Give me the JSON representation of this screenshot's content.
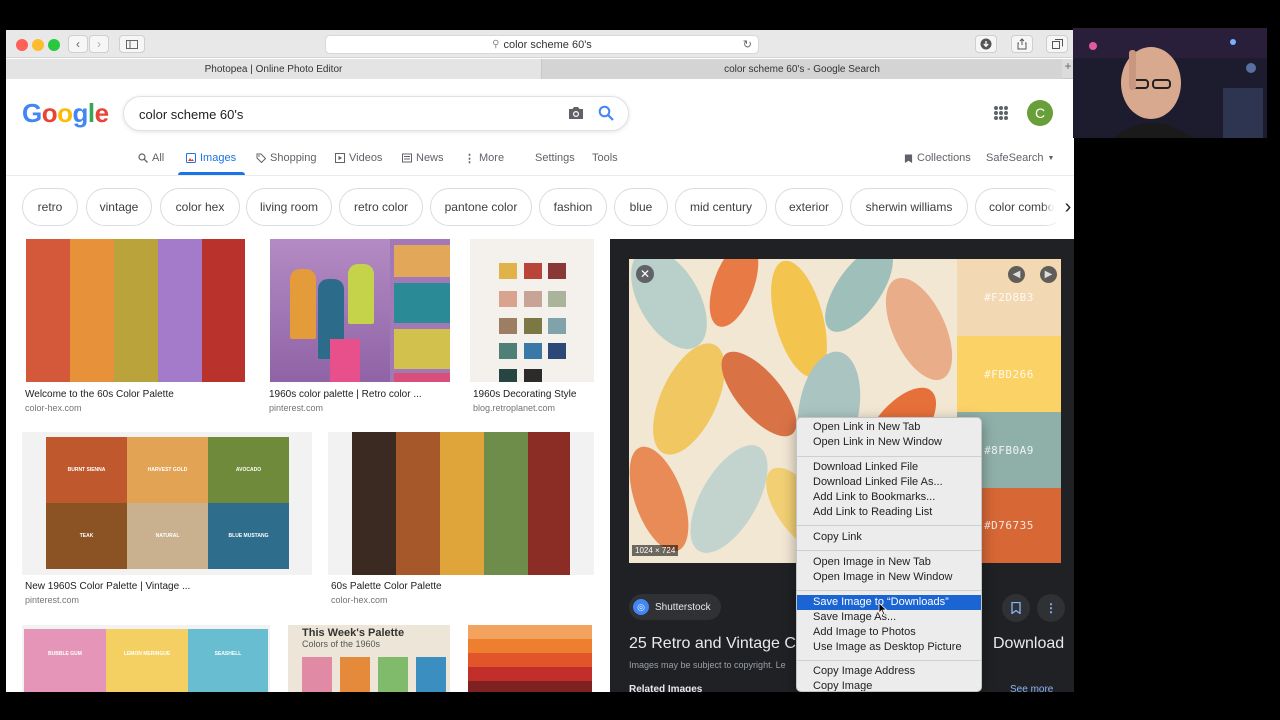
{
  "browser": {
    "url": "color scheme 60's",
    "tabs": [
      {
        "label": "Photopea | Online Photo Editor"
      },
      {
        "label": "color scheme 60's - Google Search"
      }
    ]
  },
  "google": {
    "logo": "Google",
    "query": "color scheme 60's",
    "avatar_letter": "C",
    "nav": [
      {
        "label": "All"
      },
      {
        "label": "Images"
      },
      {
        "label": "Shopping"
      },
      {
        "label": "Videos"
      },
      {
        "label": "News"
      },
      {
        "label": "More"
      },
      {
        "label": "Settings"
      },
      {
        "label": "Tools"
      }
    ],
    "collections": "Collections",
    "safesearch": "SafeSearch",
    "chips": [
      "retro",
      "vintage",
      "color hex",
      "living room",
      "retro color",
      "pantone color",
      "fashion",
      "blue",
      "mid century",
      "exterior",
      "sherwin williams",
      "color combo"
    ]
  },
  "results": [
    {
      "title": "Welcome to the 60s Color Palette",
      "source": "color-hex.com"
    },
    {
      "title": "1960s color palette | Retro color ...",
      "source": "pinterest.com"
    },
    {
      "title": "1960s Decorating Style",
      "source": "blog.retroplanet.com"
    },
    {
      "title": "New 1960S Color Palette | Vintage ...",
      "source": "pinterest.com",
      "swatches": [
        "BURNT SIENNA",
        "HARVEST GOLD",
        "AVOCADO",
        "TEAK",
        "NATURAL",
        "BLUE MUSTANG"
      ]
    },
    {
      "title": "60s Palette Color Palette",
      "source": "color-hex.com"
    },
    {
      "title": "",
      "source": "",
      "swatches": [
        "BUBBLE GUM",
        "LEMON MERINGUE",
        "SEASHELL"
      ]
    },
    {
      "title": "",
      "source": "",
      "heading": "This Week's Palette",
      "subheading": "Colors of the 1960s"
    }
  ],
  "panel": {
    "swatches": [
      "#F2D8B3",
      "#FBD266",
      "#8FB0A9",
      "#D76735"
    ],
    "dimensions": "1024 × 724",
    "source": "Shutterstock",
    "title_start": "25 Retro and Vintage Co",
    "title_end": "Download",
    "note": "Images may be subject to copyright. Le",
    "related": "Related Images",
    "see_more": "See more"
  },
  "context_menu": {
    "groups": [
      [
        "Open Link in New Tab",
        "Open Link in New Window"
      ],
      [
        "Download Linked File",
        "Download Linked File As...",
        "Add Link to Bookmarks...",
        "Add Link to Reading List"
      ],
      [
        "Copy Link"
      ],
      [
        "Open Image in New Tab",
        "Open Image in New Window"
      ],
      [
        "Save Image to “Downloads”",
        "Save Image As...",
        "Add Image to Photos",
        "Use Image as Desktop Picture"
      ],
      [
        "Copy Image Address",
        "Copy Image"
      ]
    ],
    "highlighted": "Save Image to “Downloads”"
  },
  "colors": {
    "accent": "#1a73e8",
    "menu_highlight": "#1b64d3",
    "panel_bg": "#202124"
  }
}
